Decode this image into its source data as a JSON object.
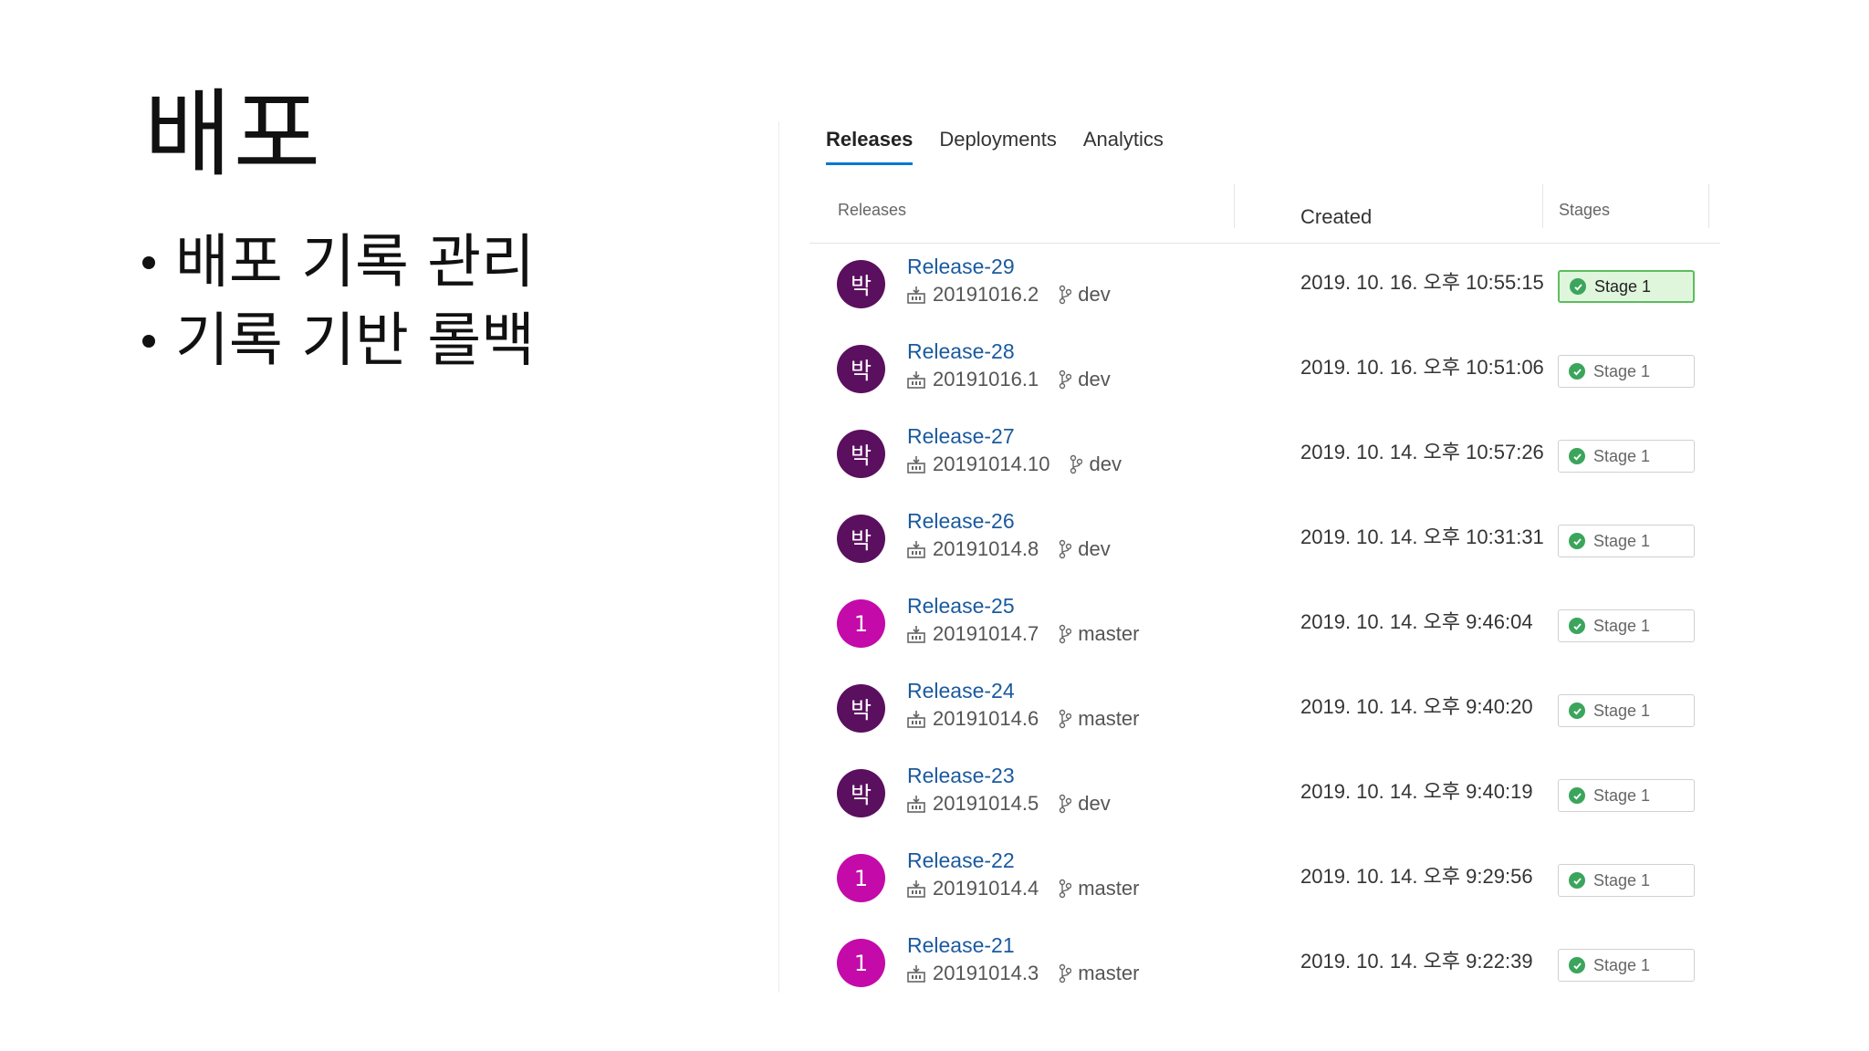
{
  "slide": {
    "title": "배포",
    "bullets": [
      "배포 기록 관리",
      "기록 기반 롤백"
    ]
  },
  "tabs": [
    {
      "label": "Releases",
      "active": true
    },
    {
      "label": "Deployments",
      "active": false
    },
    {
      "label": "Analytics",
      "active": false
    }
  ],
  "columns": {
    "releases": "Releases",
    "created": "Created",
    "stages": "Stages"
  },
  "colors": {
    "accent": "#0078d4",
    "link": "#1a5a9e",
    "avatar_dark": "#5b0f5f",
    "avatar_magenta": "#c40aa9",
    "success": "#3ba55c"
  },
  "icons": [
    "build-icon",
    "branch-icon",
    "check-circle-icon"
  ],
  "releases": [
    {
      "avatar": "박",
      "name": "Release-29",
      "build": "20191016.2",
      "branch": "dev",
      "created": "2019. 10. 16. 오후 10:55:15",
      "stage": "Stage 1"
    },
    {
      "avatar": "박",
      "name": "Release-28",
      "build": "20191016.1",
      "branch": "dev",
      "created": "2019. 10. 16. 오후 10:51:06",
      "stage": "Stage 1"
    },
    {
      "avatar": "박",
      "name": "Release-27",
      "build": "20191014.10",
      "branch": "dev",
      "created": "2019. 10. 14. 오후 10:57:26",
      "stage": "Stage 1"
    },
    {
      "avatar": "박",
      "name": "Release-26",
      "build": "20191014.8",
      "branch": "dev",
      "created": "2019. 10. 14. 오후 10:31:31",
      "stage": "Stage 1"
    },
    {
      "avatar": "1",
      "name": "Release-25",
      "build": "20191014.7",
      "branch": "master",
      "created": "2019. 10. 14. 오후 9:46:04",
      "stage": "Stage 1"
    },
    {
      "avatar": "박",
      "name": "Release-24",
      "build": "20191014.6",
      "branch": "master",
      "created": "2019. 10. 14. 오후 9:40:20",
      "stage": "Stage 1"
    },
    {
      "avatar": "박",
      "name": "Release-23",
      "build": "20191014.5",
      "branch": "dev",
      "created": "2019. 10. 14. 오후 9:40:19",
      "stage": "Stage 1"
    },
    {
      "avatar": "1",
      "name": "Release-22",
      "build": "20191014.4",
      "branch": "master",
      "created": "2019. 10. 14. 오후 9:29:56",
      "stage": "Stage 1"
    },
    {
      "avatar": "1",
      "name": "Release-21",
      "build": "20191014.3",
      "branch": "master",
      "created": "2019. 10. 14. 오후 9:22:39",
      "stage": "Stage 1"
    }
  ]
}
